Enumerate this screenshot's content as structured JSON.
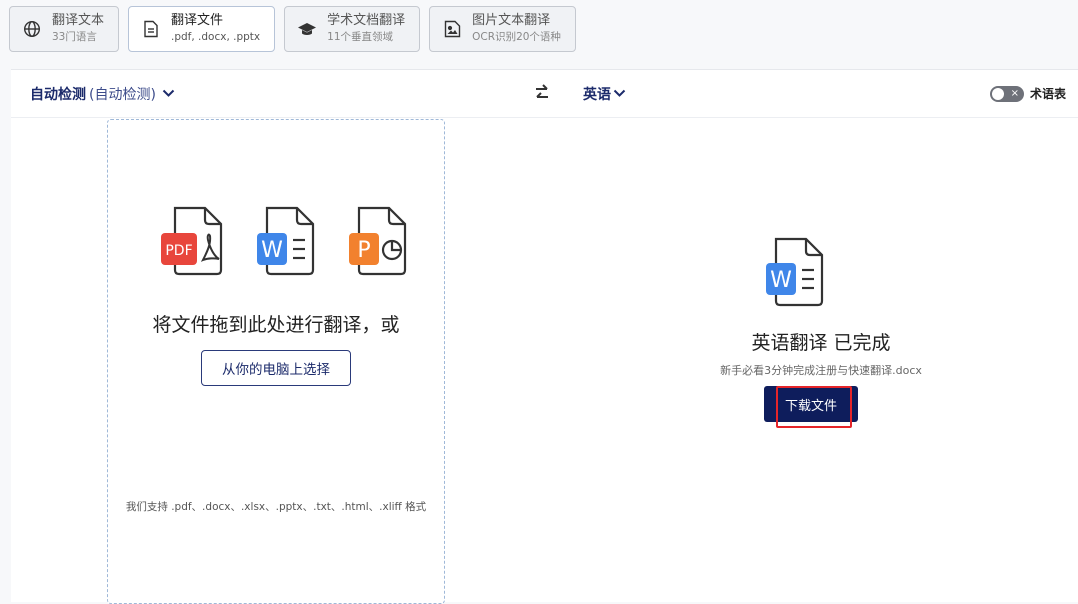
{
  "tabs": [
    {
      "title": "翻译文本",
      "subtitle": "33门语言",
      "icon": "globe-icon",
      "active": false
    },
    {
      "title": "翻译文件",
      "subtitle": ".pdf, .docx, .pptx",
      "icon": "document-icon",
      "active": true
    },
    {
      "title": "学术文档翻译",
      "subtitle": "11个垂直领域",
      "icon": "graduation-cap-icon",
      "active": false
    },
    {
      "title": "图片文本翻译",
      "subtitle": "OCR识别20个语种",
      "icon": "image-icon",
      "active": false
    }
  ],
  "lang_bar": {
    "source_main": "自动检测",
    "source_detected": "(自动检测)",
    "target": "英语",
    "glossary_label": "术语表",
    "glossary_toggle_mark": "×"
  },
  "upload": {
    "file_badges": {
      "pdf": "PDF",
      "word": "W",
      "ppt": "P"
    },
    "drop_text": "将文件拖到此处进行翻译，或",
    "choose_button": "从你的电脑上选择",
    "supported_formats": "我们支持 .pdf、.docx、.xlsx、.pptx、.txt、.html、.xliff 格式"
  },
  "result": {
    "file_badge": "W",
    "title": "英语翻译 已完成",
    "file_name": "新手必看3分钟完成注册与快速翻译.docx",
    "download_button": "下载文件"
  },
  "colors": {
    "accent": "#0e1d5c",
    "pdf": "#e8463c",
    "word": "#3f86e9",
    "ppt": "#f2812e",
    "highlight": "#e5252a"
  }
}
